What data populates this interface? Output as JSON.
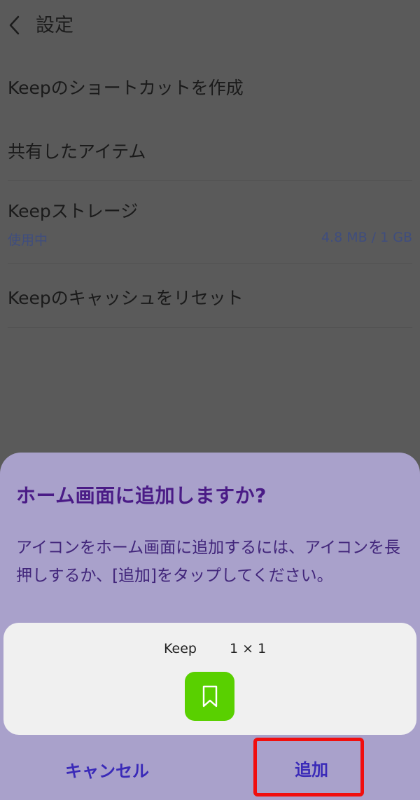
{
  "header": {
    "back_icon": "chevron-left-icon",
    "title": "設定"
  },
  "settings": {
    "shortcut": "Keepのショートカットを作成",
    "shared": "共有したアイテム",
    "storage": {
      "label": "Keepストレージ",
      "status": "使用中",
      "usage": "4.8 MB / 1 GB"
    },
    "cache": "Keepのキャッシュをリセット"
  },
  "dialog": {
    "title": "ホーム画面に追加しますか?",
    "description": "アイコンをホーム画面に追加するには、アイコンを長押しするか、[追加]をタップしてください。",
    "widget": {
      "name": "Keep",
      "size": "1 × 1",
      "icon": "bookmark-icon",
      "icon_color": "#59d000"
    },
    "cancel_label": "キャンセル",
    "add_label": "追加"
  },
  "colors": {
    "sheet_background": "#a9a1cb",
    "accent": "#3a2ab8",
    "highlight": "#f10e0e"
  }
}
